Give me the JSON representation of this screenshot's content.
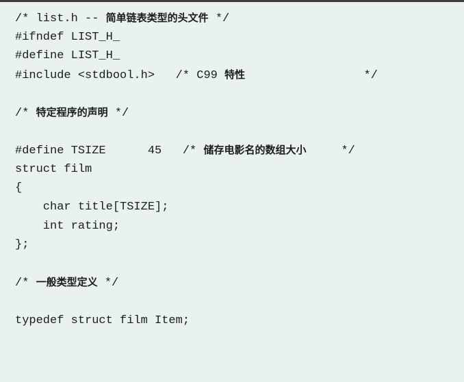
{
  "code": {
    "lines": [
      "/* list.h -- 简单链表类型的头文件 */",
      "#ifndef LIST_H_",
      "#define LIST_H_",
      "#include <stdbool.h>   /* C99 特性                 */",
      "",
      "/* 特定程序的声明 */",
      "",
      "#define TSIZE      45   /* 储存电影名的数组大小     */",
      "struct film",
      "{",
      "    char title[TSIZE];",
      "    int rating;",
      "};",
      "",
      "/* 一般类型定义 */",
      "",
      "typedef struct film Item;"
    ]
  }
}
